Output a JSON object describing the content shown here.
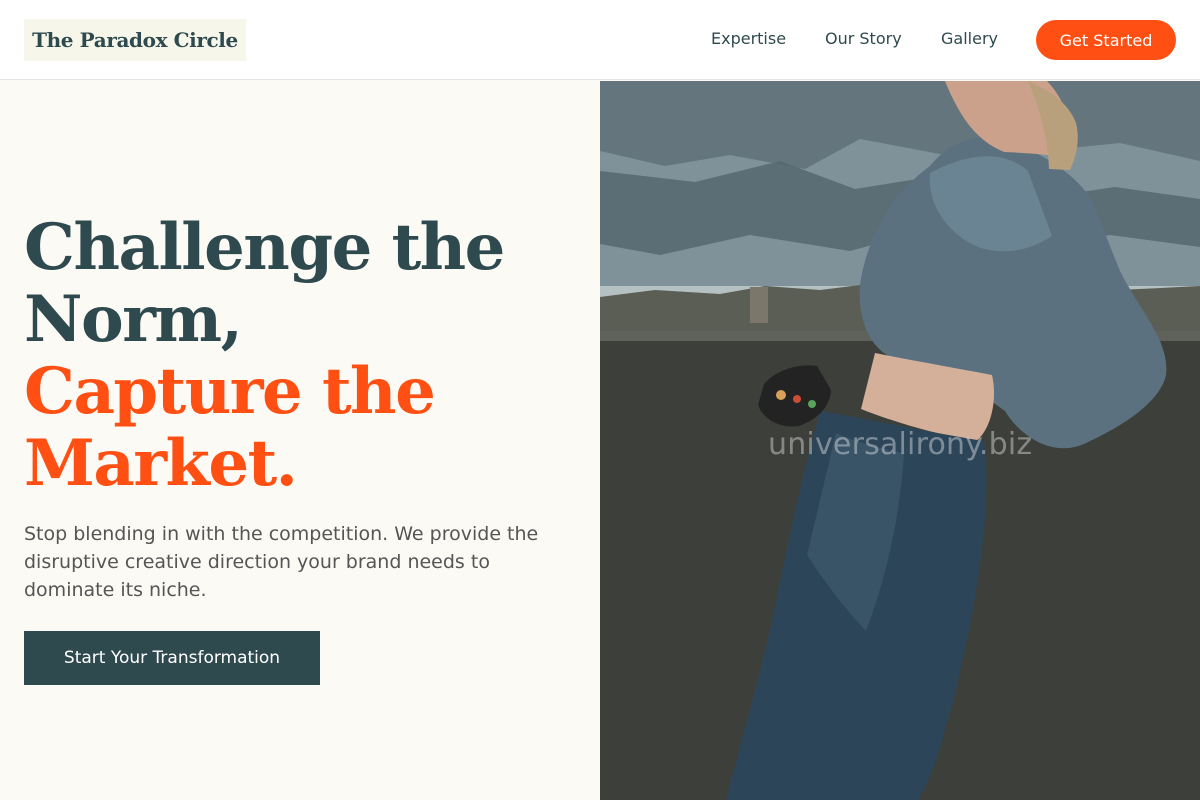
{
  "brand": {
    "name": "The Paradox Circle",
    "colors": {
      "primary": "#2f4a4f",
      "accent": "#ff4f12",
      "background": "#fbfaf5"
    }
  },
  "nav": {
    "links": [
      "Expertise",
      "Our Story",
      "Gallery"
    ],
    "cta": "Get Started"
  },
  "hero": {
    "headline_dark": [
      "Challenge the",
      "Norm,"
    ],
    "headline_accent": [
      "Capture the",
      "Market."
    ],
    "subtext": "Stop blending in with the competition. We provide the disruptive creative direction your brand needs to dominate its niche.",
    "button": "Start Your Transformation"
  },
  "image": {
    "subject": "woman in denim jacket and jeans leaning against concrete wall at dusk",
    "watermark": "universalirony.biz"
  }
}
